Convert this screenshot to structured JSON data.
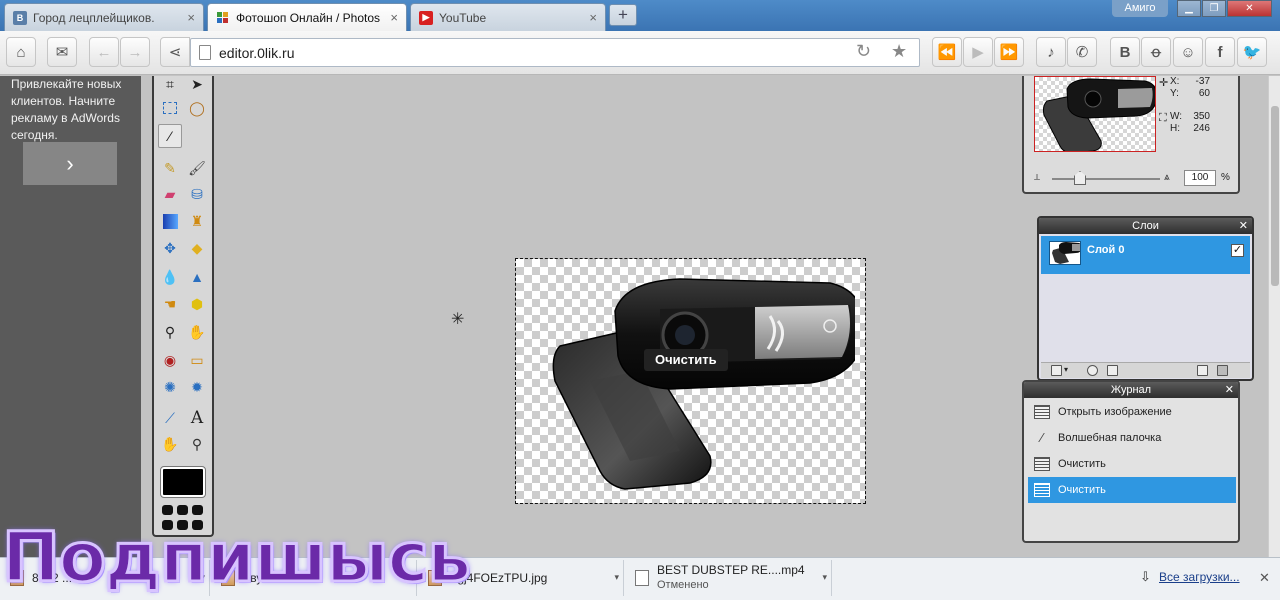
{
  "browser": {
    "tabs": [
      {
        "title": "Город лецплейщиков.",
        "favicon_text": "B",
        "favicon_color": "#5b7fa8",
        "active": false
      },
      {
        "title": "Фотошоп Онлайн / Photos",
        "favicon_text": "",
        "favicon_color": "#3b9a3b",
        "active": true
      },
      {
        "title": "YouTube",
        "favicon_text": "▶",
        "favicon_color": "#d82020",
        "active": false
      }
    ],
    "new_tab_label": "+",
    "profile_label": "Амиго",
    "url": "editor.0lik.ru"
  },
  "ad": {
    "text": "Привлекайте новых клиентов. Начните рекламу в AdWords сегодня.",
    "next_label": "›"
  },
  "canvas": {
    "tooltip": "Очистить"
  },
  "navigator": {
    "x_label": "X:",
    "x_value": "-37",
    "y_label": "Y:",
    "y_value": "60",
    "w_label": "W:",
    "w_value": "350",
    "h_label": "H:",
    "h_value": "246",
    "zoom_value": "100",
    "zoom_unit": "%"
  },
  "layers": {
    "title": "Слои",
    "items": [
      {
        "name": "Слой 0",
        "visible": true
      }
    ]
  },
  "history": {
    "title": "Журнал",
    "items": [
      {
        "label": "Открыть изображение",
        "icon": "doc-icon"
      },
      {
        "label": "Волшебная палочка",
        "icon": "magic-wand-icon"
      },
      {
        "label": "Очистить",
        "icon": "doc-icon"
      },
      {
        "label": "Очистить",
        "icon": "doc-icon",
        "selected": true
      }
    ]
  },
  "downloads": {
    "items": [
      {
        "name": "8932 ...",
        "status": ""
      },
      {
        "name": "Звук ... 5 ...",
        "status": ""
      },
      {
        "name": "Fgj4FOEzTPU.jpg",
        "status": ""
      },
      {
        "name": "BEST DUBSTEP RE....mp4",
        "status": "Отменено"
      }
    ],
    "all_label": "Все загрузки...",
    "close_label": "✕"
  },
  "overlay": {
    "subscribe_text": "Подпишысь"
  },
  "colors": {
    "selection_blue": "#2f97e1",
    "panel_header": "#2e2e2e",
    "primary_color": "#000000"
  }
}
